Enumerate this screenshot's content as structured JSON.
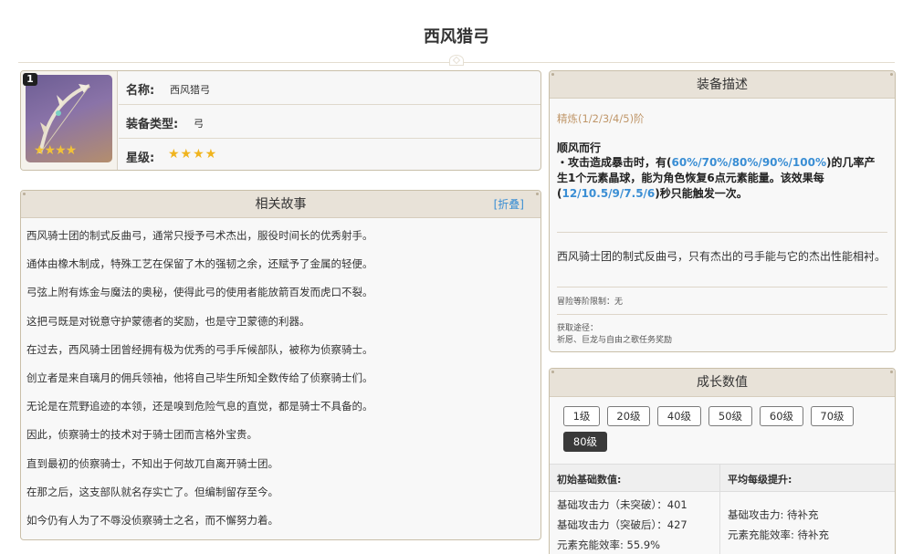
{
  "page": {
    "title": "西风猎弓"
  },
  "info": {
    "badge": "1",
    "name_label": "名称:",
    "name_value": "西风猎弓",
    "type_label": "装备类型:",
    "type_value": "弓",
    "rarity_label": "星级:",
    "rarity_stars": 4,
    "stars_text": "★★★★"
  },
  "story": {
    "title": "相关故事",
    "fold_label": "[折叠]",
    "lines": [
      "西风骑士团的制式反曲弓，通常只授予弓术杰出，服役时间长的优秀射手。",
      "通体由橡木制成，特殊工艺在保留了木的强韧之余，还赋予了金属的轻便。",
      "弓弦上附有炼金与魔法的奥秘，使得此弓的使用者能放箭百发而虎口不裂。",
      "这把弓既是对锐意守护蒙德者的奖励，也是守卫蒙德的利器。",
      "在过去，西风骑士团曾经拥有极为优秀的弓手斥候部队，被称为侦察骑士。",
      "创立者是来自璃月的佣兵领袖，他将自己毕生所知全数传给了侦察骑士们。",
      "无论是在荒野追迹的本领，还是嗅到危险气息的直觉，都是骑士不具备的。",
      "因此，侦察骑士的技术对于骑士团而言格外宝贵。",
      "直到最初的侦察骑士，不知出于何故兀自离开骑士团。",
      "在那之后，这支部队就名存实亡了。但编制留存至今。",
      "如今仍有人为了不辱没侦察骑士之名，而不懈努力着。"
    ]
  },
  "desc": {
    "title": "装备描述",
    "refine": "精炼(1/2/3/4/5)阶",
    "skill_name": "顺风而行",
    "skill_p1": "・攻击造成暴击时，有(",
    "skill_v1": "60%/70%/80%/90%/100%",
    "skill_p2": ")的几率产生1个元素晶球，能为角色恢复6点元素能量。该效果每(",
    "skill_v2": "12/10.5/9/7.5/6",
    "skill_p3": ")秒只能触发一次。",
    "flavor": "西风骑士团的制式反曲弓，只有杰出的弓手能与它的杰出性能相衬。",
    "ascension_limit": "冒险等阶限制：无",
    "source_label": "获取途径：",
    "source_value": "祈愿、巨龙与自由之歌任务奖励"
  },
  "growth": {
    "title": "成长数值",
    "levels": [
      "1级",
      "20级",
      "40级",
      "50级",
      "60级",
      "70级",
      "80级"
    ],
    "active_level": "80级",
    "col1_head": "初始基础数值:",
    "col2_head": "平均每级提升:",
    "base_stats": [
      "基础攻击力（未突破）：401",
      "基础攻击力（突破后）：427",
      "元素充能效率: 55.9%"
    ],
    "per_level": [
      "基础攻击力: 待补充",
      "元素充能效率: 待补充"
    ]
  },
  "colors": {
    "panel_border": "#c9bfa9",
    "panel_head": "#e8e2d8",
    "link_blue": "#3a8ed4",
    "refine_tan": "#c0976a",
    "star_gold": "#f0b41e",
    "active_button": "#3a3a3a"
  }
}
